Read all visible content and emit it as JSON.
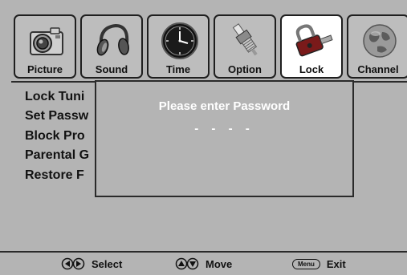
{
  "tabs": [
    {
      "label": "Picture",
      "icon": "camera-icon",
      "active": false
    },
    {
      "label": "Sound",
      "icon": "headphones-icon",
      "active": false
    },
    {
      "label": "Time",
      "icon": "clock-icon",
      "active": false
    },
    {
      "label": "Option",
      "icon": "spark-plug-icon",
      "active": false
    },
    {
      "label": "Lock",
      "icon": "lock-icon",
      "active": true
    },
    {
      "label": "Channel",
      "icon": "globe-icon",
      "active": false
    }
  ],
  "menu": {
    "items": [
      "Lock Tuni",
      "Set Passw",
      "Block Pro",
      "Parental G",
      "Restore F"
    ]
  },
  "dialog": {
    "title": "Please enter Password",
    "mask": "- - - -"
  },
  "footer": {
    "select_label": "Select",
    "move_label": "Move",
    "menu_key": "Menu",
    "exit_label": "Exit"
  }
}
